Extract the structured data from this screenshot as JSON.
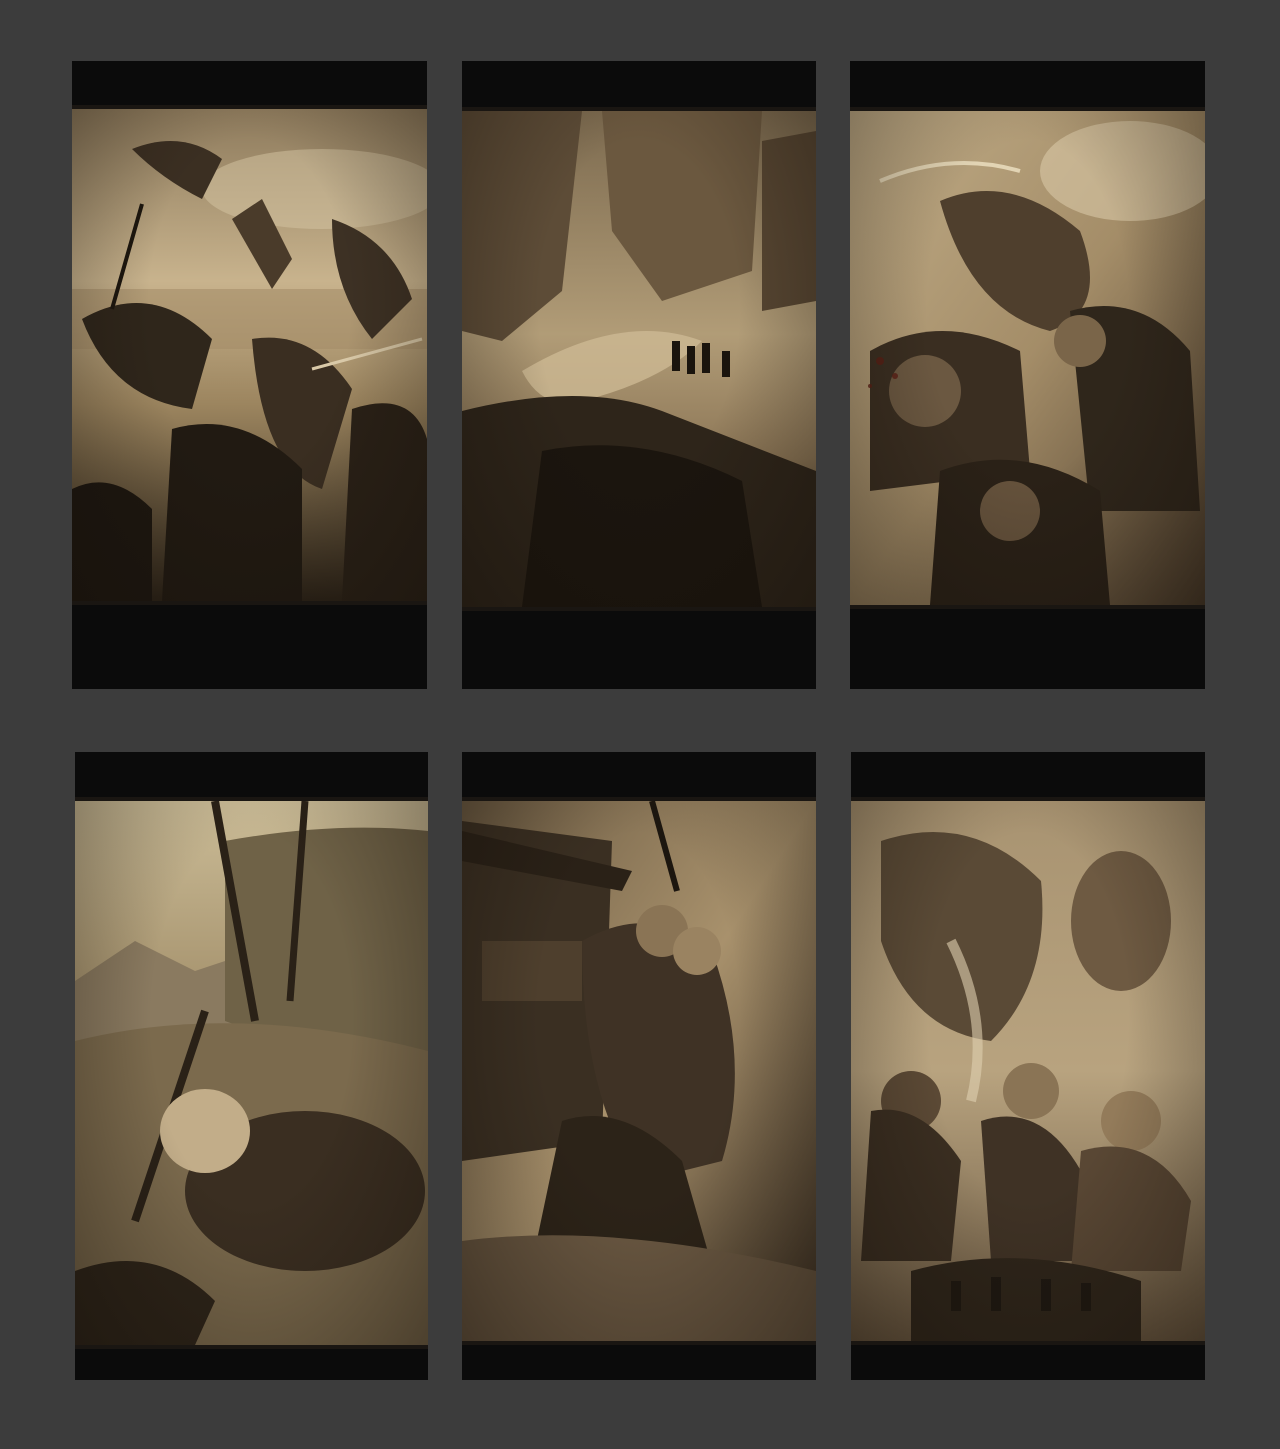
{
  "palette": {
    "background": "#3c3c3c",
    "frame": "#0b0b0b",
    "sepia_light": "#c9b48e",
    "sepia_mid": "#8a7352",
    "sepia_dark": "#2e241a"
  },
  "panels": [
    {
      "id": "battle-charge",
      "icon": "sepia-battle-illustration"
    },
    {
      "id": "canyon-march",
      "icon": "sepia-canyon-illustration"
    },
    {
      "id": "sword-attack",
      "icon": "sepia-attack-illustration"
    },
    {
      "id": "baby-battlefield",
      "icon": "sepia-infant-illustration"
    },
    {
      "id": "warrior-carry",
      "icon": "sepia-warrior-illustration"
    },
    {
      "id": "heroes-montage",
      "icon": "sepia-heroes-illustration"
    }
  ]
}
